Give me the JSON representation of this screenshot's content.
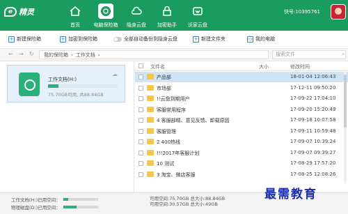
{
  "app": {
    "logo": "精灵",
    "brand_color": "#1a9c5f"
  },
  "nav": [
    {
      "label": "首页",
      "icon": "home-icon"
    },
    {
      "label": "电脑保险箱",
      "icon": "safe-icon"
    },
    {
      "label": "隐身云盘",
      "icon": "cloud-icon"
    },
    {
      "label": "加密助手",
      "icon": "lock-icon"
    },
    {
      "label": "沃家云盘",
      "icon": "wo-cloud-icon"
    }
  ],
  "user": {
    "label": "快号:10395761"
  },
  "toolbar": {
    "new_safe": "新建保险箱",
    "add_safe": "加密到保险箱",
    "auto_backup": "全部自动备份到隐身云盘",
    "new_folder": "新建文件夹",
    "my_computer": "我的电脑"
  },
  "breadcrumb": [
    "我的保险箱",
    "工作文档"
  ],
  "search": {
    "placeholder": "搜索文件"
  },
  "drive": {
    "name": "工作文档(H:)",
    "size_text": "75.70GB可用, 共88.84GB",
    "used_fraction": 0.15
  },
  "table": {
    "headers": {
      "name": "文件名",
      "size": "大小",
      "date": "修改时间"
    },
    "rows": [
      {
        "name": "产品部",
        "date": "18-01-04 12:06:43"
      },
      {
        "name": "市场部",
        "date": "17-12-11 09:50:20"
      },
      {
        "name": "!!云盘到期用户",
        "date": "17-09-22 17:04:10"
      },
      {
        "name": "客服常用程序",
        "date": "17-09-20 15:20:49"
      },
      {
        "name": "4 客服部精、意见反馈、卸载原因",
        "date": "17-09-18 10:07:58"
      },
      {
        "name": "客服管理",
        "date": "17-09-11 10:59:48"
      },
      {
        "name": "2 400热线",
        "date": "17-09-07 10:39:24"
      },
      {
        "name": "!!!2017年客服计划",
        "date": "17-09-07 09:39:27"
      },
      {
        "name": "10 测试",
        "date": "17-08-29 17:57:20"
      },
      {
        "name": "3 淘宝、微店客服",
        "date": "17-08-25 12:08:26"
      }
    ]
  },
  "status": {
    "line1": "工作文档(H:)已用空间：",
    "line2": "物理磁盘(D:)已用空间：",
    "right1": "可用空间:75.70GB  总大小:88.84GB",
    "right2": "可用空间:30.57GB  总大小:49GB"
  },
  "watermark": "最需教育"
}
